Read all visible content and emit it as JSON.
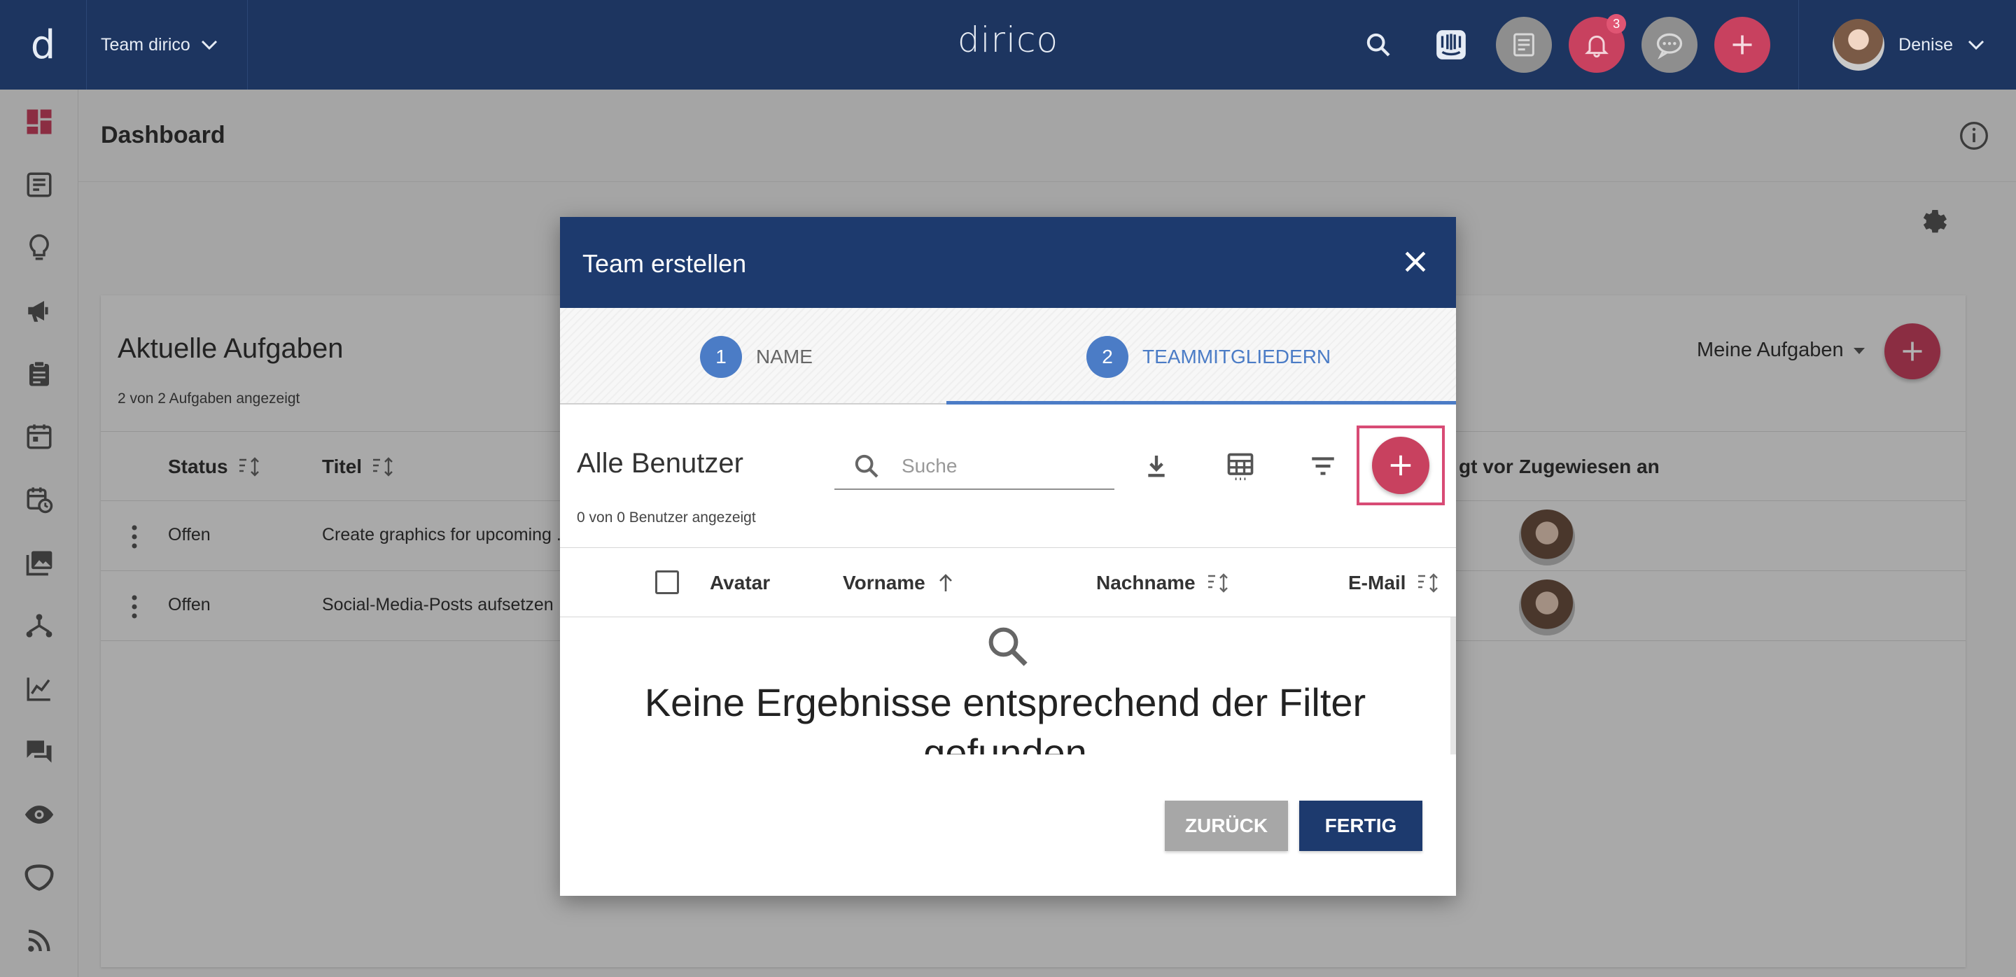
{
  "topbar": {
    "logo_letter": "d",
    "team_selector": "Team dirico",
    "brand": "dirico",
    "notification_count": "3",
    "user_name": "Denise",
    "icons": [
      "search-icon",
      "intercom-icon",
      "notes-icon",
      "bell-icon",
      "chat-icon",
      "plus-icon"
    ]
  },
  "sidebar": {
    "items": [
      "dashboard-icon",
      "tasks-list-icon",
      "lightbulb-icon",
      "megaphone-icon",
      "clipboard-icon",
      "calendar-icon",
      "calendar-clock-icon",
      "media-library-icon",
      "hierarchy-icon",
      "analytics-icon",
      "forum-icon",
      "eye-icon",
      "shield-icon",
      "rss-icon"
    ]
  },
  "page": {
    "title": "Dashboard"
  },
  "tasks_card": {
    "title": "Aktuelle Aufgaben",
    "subtitle": "2 von 2 Aufgaben angezeigt",
    "filter_label": "Meine Aufgaben",
    "columns": {
      "status": "Status",
      "title": "Titel",
      "created_by_partial": "gt vor",
      "assigned": "Zugewiesen an"
    },
    "rows": [
      {
        "status": "Offen",
        "title": "Create graphics for upcoming ..."
      },
      {
        "status": "Offen",
        "title": "Social-Media-Posts aufsetzen"
      }
    ]
  },
  "modal": {
    "title": "Team erstellen",
    "steps": [
      {
        "num": "1",
        "label": "NAME"
      },
      {
        "num": "2",
        "label": "TEAMMITGLIEDERN"
      }
    ],
    "users_title": "Alle Benutzer",
    "users_subtitle": "0 von 0 Benutzer angezeigt",
    "search_placeholder": "Suche",
    "columns": {
      "avatar": "Avatar",
      "firstname": "Vorname",
      "lastname": "Nachname",
      "email": "E-Mail"
    },
    "empty_message": "Keine Ergebnisse entsprechend der Filter gefunden",
    "back_label": "ZURÜCK",
    "done_label": "FERTIG"
  },
  "colors": {
    "navbar": "#1d3560",
    "accent_red": "#c8415f",
    "step_blue": "#4b7cc6",
    "primary_button": "#1d3a6e",
    "highlight": "#d84b75"
  }
}
